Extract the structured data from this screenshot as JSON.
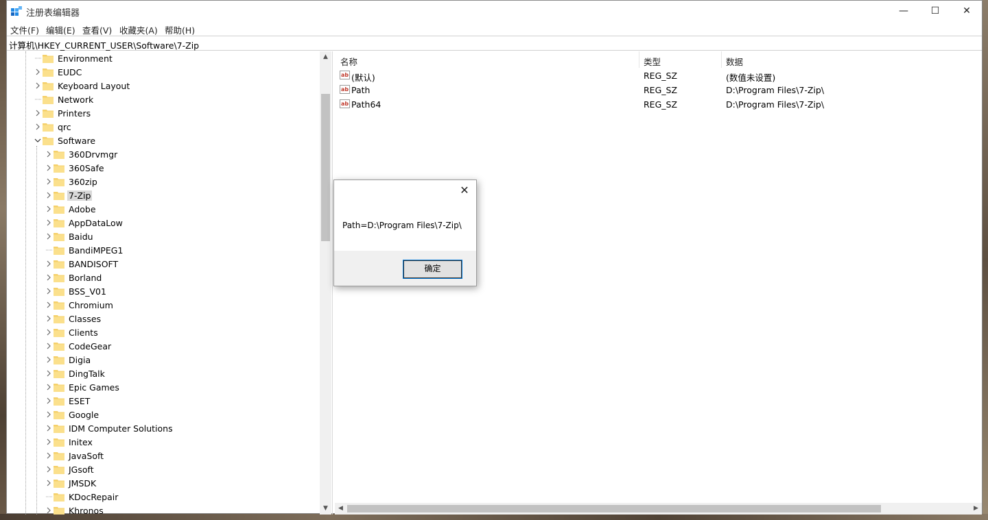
{
  "window": {
    "title": "注册表编辑器",
    "controls": {
      "minimize": "—",
      "maximize": "☐",
      "close": "✕"
    }
  },
  "menu": [
    "文件(F)",
    "编辑(E)",
    "查看(V)",
    "收藏夹(A)",
    "帮助(H)"
  ],
  "address": "计算机\\HKEY_CURRENT_USER\\Software\\7-Zip",
  "tree": {
    "top_items": [
      {
        "label": "Environment",
        "expandable": false
      },
      {
        "label": "EUDC",
        "expandable": true
      },
      {
        "label": "Keyboard Layout",
        "expandable": true
      },
      {
        "label": "Network",
        "expandable": false
      },
      {
        "label": "Printers",
        "expandable": true
      },
      {
        "label": "qrc",
        "expandable": true
      },
      {
        "label": "Software",
        "expandable": true,
        "expanded": true
      }
    ],
    "software_children": [
      {
        "label": "360Drvmgr",
        "expandable": true
      },
      {
        "label": "360Safe",
        "expandable": true
      },
      {
        "label": "360zip",
        "expandable": true
      },
      {
        "label": "7-Zip",
        "expandable": true,
        "selected": true
      },
      {
        "label": "Adobe",
        "expandable": true
      },
      {
        "label": "AppDataLow",
        "expandable": true
      },
      {
        "label": "Baidu",
        "expandable": true
      },
      {
        "label": "BandiMPEG1",
        "expandable": false
      },
      {
        "label": "BANDISOFT",
        "expandable": true
      },
      {
        "label": "Borland",
        "expandable": true
      },
      {
        "label": "BSS_V01",
        "expandable": true
      },
      {
        "label": "Chromium",
        "expandable": true
      },
      {
        "label": "Classes",
        "expandable": true
      },
      {
        "label": "Clients",
        "expandable": true
      },
      {
        "label": "CodeGear",
        "expandable": true
      },
      {
        "label": "Digia",
        "expandable": true
      },
      {
        "label": "DingTalk",
        "expandable": true
      },
      {
        "label": "Epic Games",
        "expandable": true
      },
      {
        "label": "ESET",
        "expandable": true
      },
      {
        "label": "Google",
        "expandable": true
      },
      {
        "label": "IDM Computer Solutions",
        "expandable": true
      },
      {
        "label": "Initex",
        "expandable": true
      },
      {
        "label": "JavaSoft",
        "expandable": true
      },
      {
        "label": "JGsoft",
        "expandable": true
      },
      {
        "label": "JMSDK",
        "expandable": true
      },
      {
        "label": "KDocRepair",
        "expandable": false
      },
      {
        "label": "Khronos",
        "expandable": true
      }
    ]
  },
  "list": {
    "headers": {
      "name": "名称",
      "type": "类型",
      "data": "数据"
    },
    "rows": [
      {
        "icon": "ab",
        "name": "(默认)",
        "type": "REG_SZ",
        "data": "(数值未设置)"
      },
      {
        "icon": "ab",
        "name": "Path",
        "type": "REG_SZ",
        "data": "D:\\Program Files\\7-Zip\\"
      },
      {
        "icon": "ab",
        "name": "Path64",
        "type": "REG_SZ",
        "data": "D:\\Program Files\\7-Zip\\"
      }
    ]
  },
  "dialog": {
    "message": "Path=D:\\Program Files\\7-Zip\\",
    "ok_label": "确定",
    "close_glyph": "✕"
  },
  "colors": {
    "folder": "#f5d06a",
    "accent": "#0078d7",
    "selection": "#d9d9d9"
  }
}
